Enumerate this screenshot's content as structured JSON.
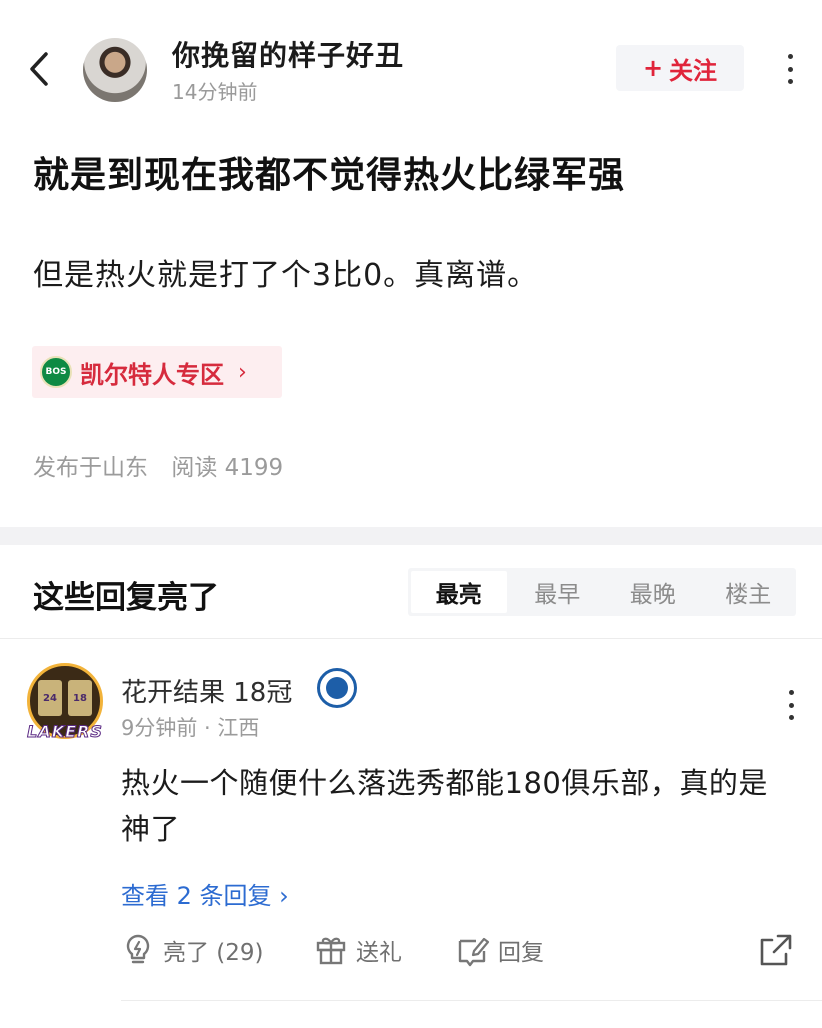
{
  "header": {
    "author_name": "你挽留的样子好丑",
    "post_time": "14分钟前",
    "follow_plus": "+",
    "follow_label": "关注"
  },
  "post": {
    "title": "就是到现在我都不觉得热火比绿军强",
    "body": "但是热火就是打了个3比0。真离谱。",
    "zone": {
      "logo_text": "BOS",
      "label": "凯尔特人专区",
      "chevron": "›"
    },
    "location": "发布于山东",
    "reads": "阅读 4199"
  },
  "replies": {
    "title": "这些回复亮了",
    "sort_tabs": [
      "最亮",
      "最早",
      "最晚",
      "楼主"
    ],
    "active_sort": "最亮"
  },
  "comment": {
    "avatar_jersey_numbers": [
      "24",
      "18"
    ],
    "avatar_wordmark": "LAKERS",
    "name": "花开结果 18冠",
    "meta": "9分钟前 · 江西",
    "text": "热火一个随便什么落选秀都能180俱乐部，真的是神了",
    "view_replies": "查看 2 条回复 ›",
    "like_label": "亮了 (29)",
    "gift_label": "送礼",
    "reply_label": "回复"
  },
  "colors": {
    "accent_red": "#e0243a",
    "link_blue": "#2c6bd1",
    "celtics_green": "#0e8a43",
    "badge_blue": "#1d5ea8"
  },
  "icons": [
    "back-arrow-icon",
    "more-icon",
    "celtics-logo-icon",
    "chevron-right-icon",
    "team-badge-icon",
    "lightbulb-icon",
    "gift-icon",
    "reply-pen-icon",
    "share-icon"
  ]
}
